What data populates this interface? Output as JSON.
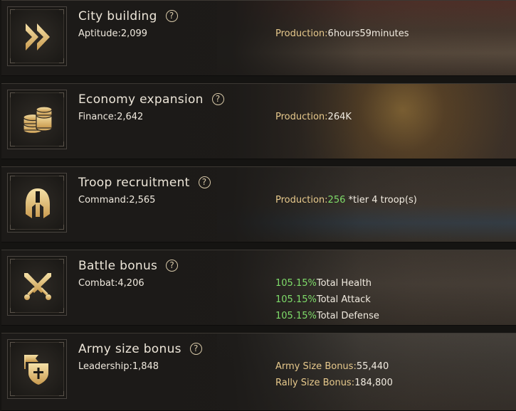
{
  "colors": {
    "gold": "#e7c98c",
    "green": "#7fdc6a",
    "card_bg": "#24221f"
  },
  "cards": [
    {
      "icon": "fast-forward-icon",
      "title": "City building",
      "help": "?",
      "stat": "Aptitude:2,099",
      "production": {
        "label": "Production:",
        "value": "6hours59minutes"
      }
    },
    {
      "icon": "coins-icon",
      "title": "Economy expansion",
      "help": "?",
      "stat": "Finance:2,642",
      "production": {
        "label": "Production:",
        "value": "264K"
      }
    },
    {
      "icon": "helmet-icon",
      "title": "Troop recruitment",
      "help": "?",
      "stat": "Command:2,565",
      "production": {
        "label": "Production:",
        "value": "256",
        "suffix": " *tier 4 troop(s)"
      }
    },
    {
      "icon": "crossed-swords-icon",
      "title": "Battle bonus",
      "help": "?",
      "stat": "Combat:4,206",
      "bonuses": [
        {
          "value": "105.15%",
          "label": "Total Health"
        },
        {
          "value": "105.15%",
          "label": "Total Attack"
        },
        {
          "value": "105.15%",
          "label": "Total Defense"
        }
      ]
    },
    {
      "icon": "banner-shield-icon",
      "title": "Army size bonus",
      "help": "?",
      "stat": "Leadership:1,848",
      "sizes": [
        {
          "label": "Army Size Bonus:",
          "value": "55,440"
        },
        {
          "label": "Rally Size Bonus:",
          "value": "184,800"
        }
      ]
    }
  ]
}
